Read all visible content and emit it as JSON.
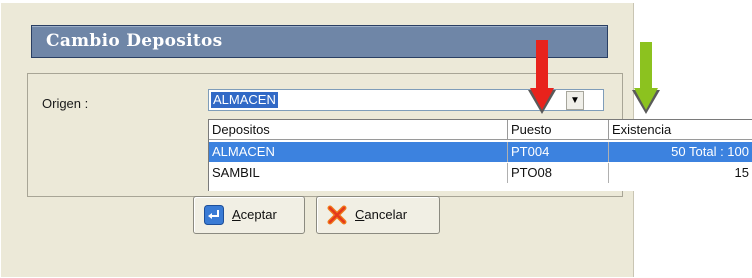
{
  "window": {
    "title": "Cambio Depositos"
  },
  "origen": {
    "label": "Origen :",
    "value": "ALMACEN"
  },
  "dropdown": {
    "columns": [
      "Depositos",
      "Puesto",
      "Existencia"
    ],
    "rows": [
      {
        "deposito": "ALMACEN",
        "puesto": "PT004",
        "existencia": "50 Total : 100",
        "selected": true
      },
      {
        "deposito": "SAMBIL",
        "puesto": "PTO08",
        "existencia": "15",
        "selected": false
      }
    ]
  },
  "buttons": {
    "aceptar": {
      "first": "A",
      "rest": "ceptar",
      "icon": "enter-icon"
    },
    "cancelar": {
      "first": "C",
      "rest": "ancelar",
      "icon": "red-x-icon"
    }
  },
  "annotations": {
    "red_arrow_color": "#e8231c",
    "green_arrow_color": "#8cc21f"
  }
}
